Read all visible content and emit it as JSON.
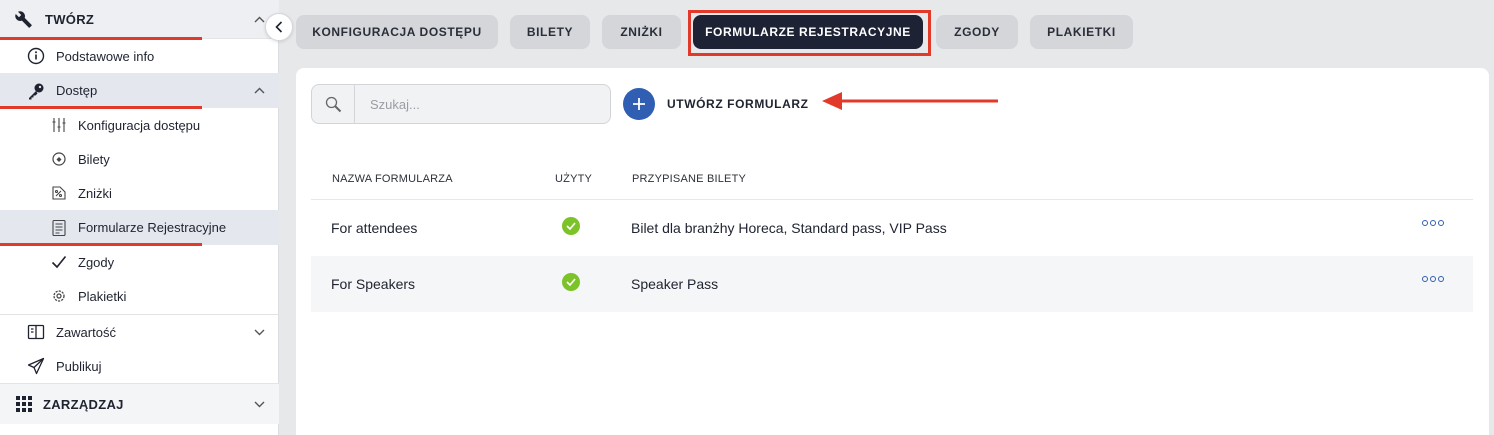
{
  "sidebar": {
    "create_section": "TWÓRZ",
    "basic_info": "Podstawowe info",
    "access": "Dostęp",
    "access_config": "Konfiguracja dostępu",
    "tickets": "Bilety",
    "discounts": "Zniżki",
    "registration_forms": "Formularze Rejestracyjne",
    "consents": "Zgody",
    "badges": "Plakietki",
    "content": "Zawartość",
    "publish": "Publikuj",
    "manage_section": "ZARZĄDZAJ"
  },
  "tabs": [
    {
      "label": "KONFIGURACJA DOSTĘPU"
    },
    {
      "label": "BILETY"
    },
    {
      "label": "ZNIŻKI"
    },
    {
      "label": "FORMULARZE REJESTRACYJNE"
    },
    {
      "label": "ZGODY"
    },
    {
      "label": "PLAKIETKI"
    }
  ],
  "toolbar": {
    "search_placeholder": "Szukaj...",
    "create_label": "UTWÓRZ FORMULARZ"
  },
  "table": {
    "headers": [
      "NAZWA FORMULARZA",
      "UŻYTY",
      "PRZYPISANE BILETY"
    ],
    "rows": [
      {
        "name": "For attendees",
        "used": true,
        "tickets": "Bilet dla branżhy Horeca, Standard pass, VIP Pass"
      },
      {
        "name": "For Speakers",
        "used": true,
        "tickets": "Speaker Pass"
      }
    ]
  },
  "colors": {
    "accent": "#2f5eb3",
    "active_tab": "#1e2235",
    "annotation": "#e23a2a",
    "success": "#7cc327"
  },
  "icons": [
    "wrench-icon",
    "info-icon",
    "key-icon",
    "sliders-icon",
    "ticket-icon",
    "discount-icon",
    "form-icon",
    "check-icon",
    "gear-icon",
    "book-icon",
    "send-icon",
    "grid-icon",
    "search-icon",
    "plus-icon",
    "more-icon"
  ]
}
